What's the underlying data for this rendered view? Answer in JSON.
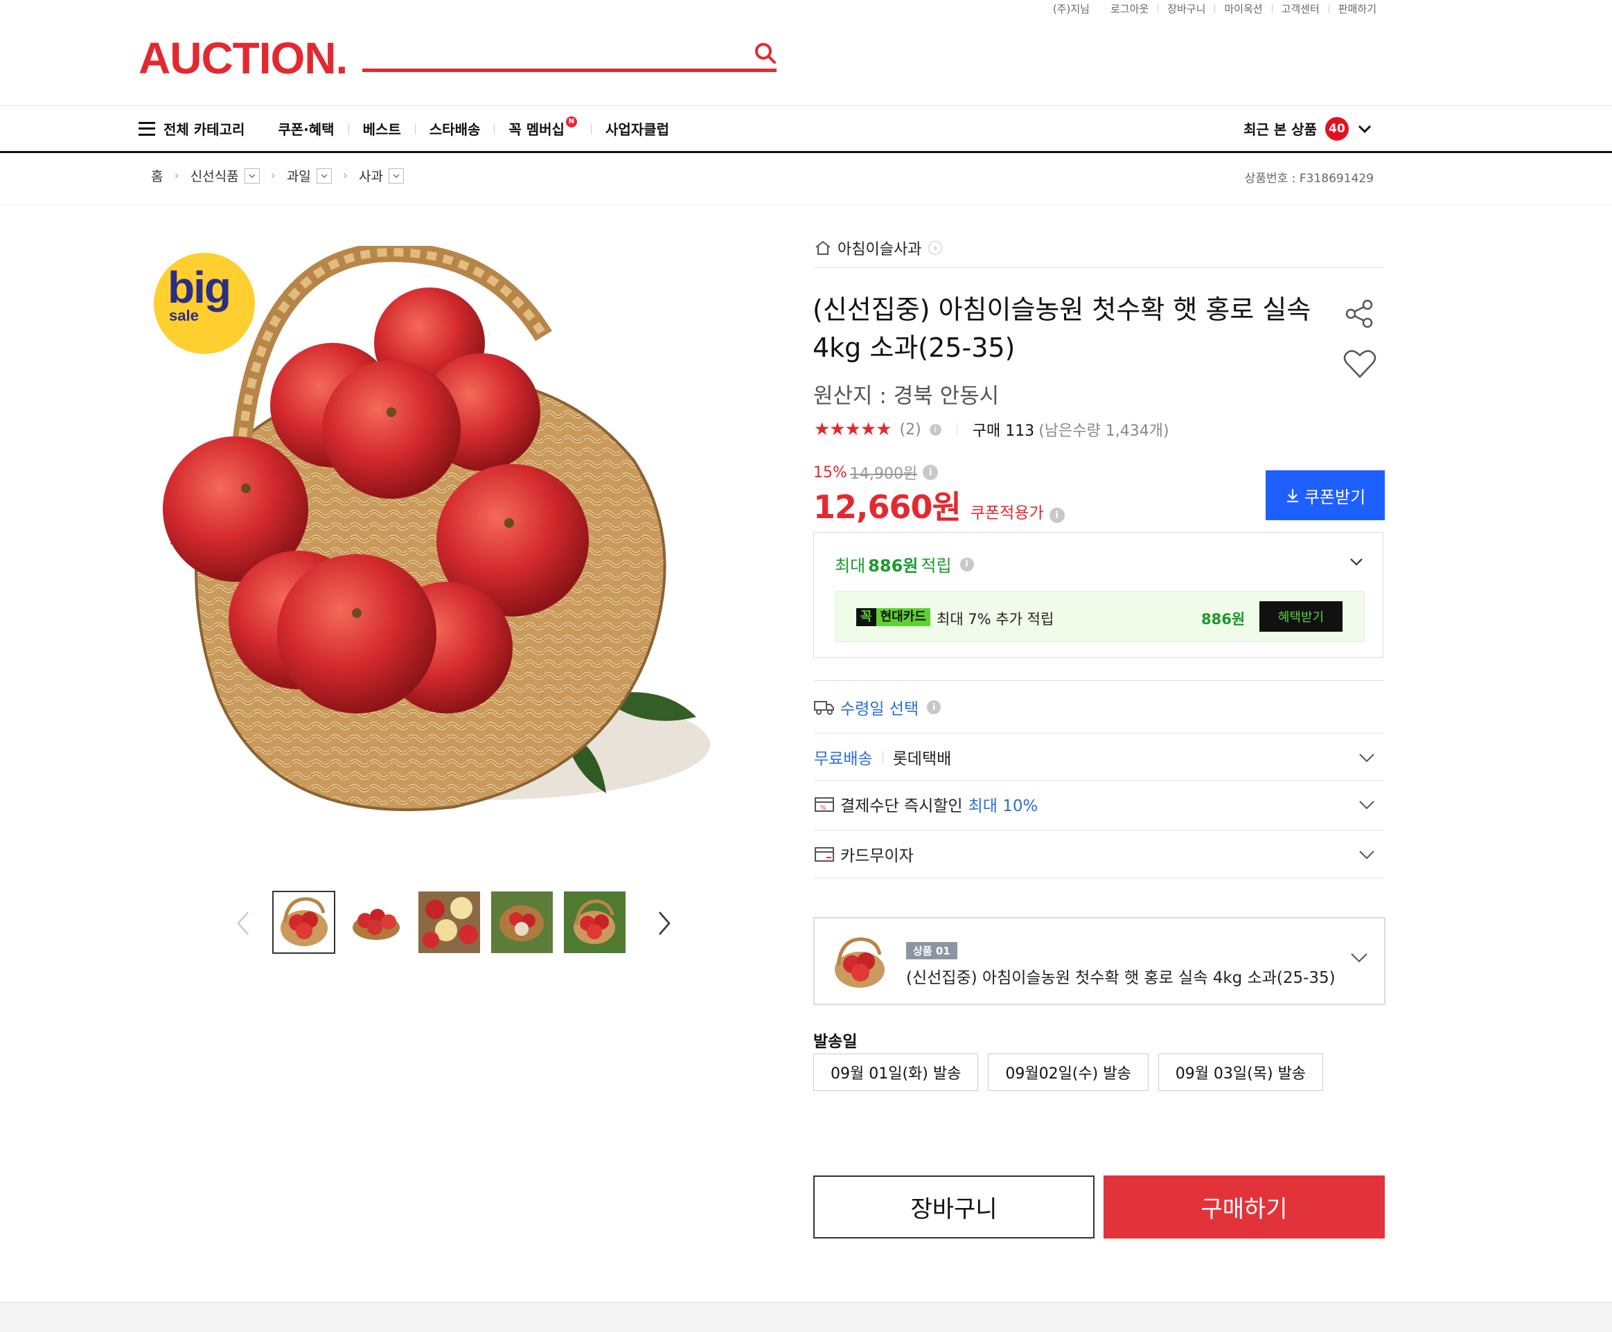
{
  "util_links": {
    "user": "(주)지님",
    "logout": "로그아웃",
    "cart": "장바구니",
    "my_auction": "마이옥션",
    "customer_center": "고객센터",
    "sell": "판매하기"
  },
  "header": {
    "logo": "AUCTION.",
    "search_placeholder": ""
  },
  "nav": {
    "all_categories": "전체 카테고리",
    "items": [
      "쿠폰·혜택",
      "베스트",
      "스타배송",
      "꼭 멤버십",
      "사업자클럽"
    ],
    "membership_badge": "N",
    "recent_label": "최근 본 상품",
    "recent_count": "40"
  },
  "breadcrumb": {
    "home": "홈",
    "levels": [
      "신선식품",
      "과일",
      "사과"
    ],
    "product_no": "상품번호 : F318691429"
  },
  "badge": {
    "line1": "big",
    "line2": "sale"
  },
  "product": {
    "seller": "아침이슬사과",
    "title": "(신선집중) 아침이슬농원 첫수확 햇 홍로 실속 4kg 소과(25-35)",
    "origin": "원산지 : 경북 안동시",
    "rating_stars": "★★★★★",
    "rating": 4.5,
    "review_count": "(2)",
    "purchase": "구매 113",
    "remaining": "(남은수량 1,434개)",
    "discount_rate": "15%",
    "original_price": "14,900원",
    "price": "12,660원",
    "price_label": "쿠폰적용가",
    "coupon_button": "쿠폰받기"
  },
  "benefit": {
    "prefix": "최대",
    "amount": "886원",
    "suffix": "적립",
    "card_tag_k": "꼭",
    "card_tag_name": "현대카드",
    "card_desc": "최대 7% 추가 적립",
    "card_amount": "886원",
    "card_button": "혜택받기"
  },
  "delivery": {
    "receive_date": "수령일 선택",
    "ship_type": "무료배송",
    "courier": "롯데택배",
    "payment_discount": "결제수단 즉시할인",
    "payment_max": "최대 10%",
    "installment": "카드무이자"
  },
  "option": {
    "tag": "상품 01",
    "name": "(신선집중) 아침이슬농원 첫수확 햇 홍로 실속 4kg 소과(25-35)"
  },
  "ship_dates": {
    "label": "발송일",
    "dates": [
      "09월 01일(화) 발송",
      "09월02일(수) 발송",
      "09월 03일(목) 발송"
    ]
  },
  "actions": {
    "cart": "장바구니",
    "buy": "구매하기"
  },
  "colors": {
    "brand_red": "#e3292f",
    "coupon_blue": "#1e5fff",
    "benefit_green": "#1a9b2f",
    "link_blue": "#2a6ed8"
  }
}
